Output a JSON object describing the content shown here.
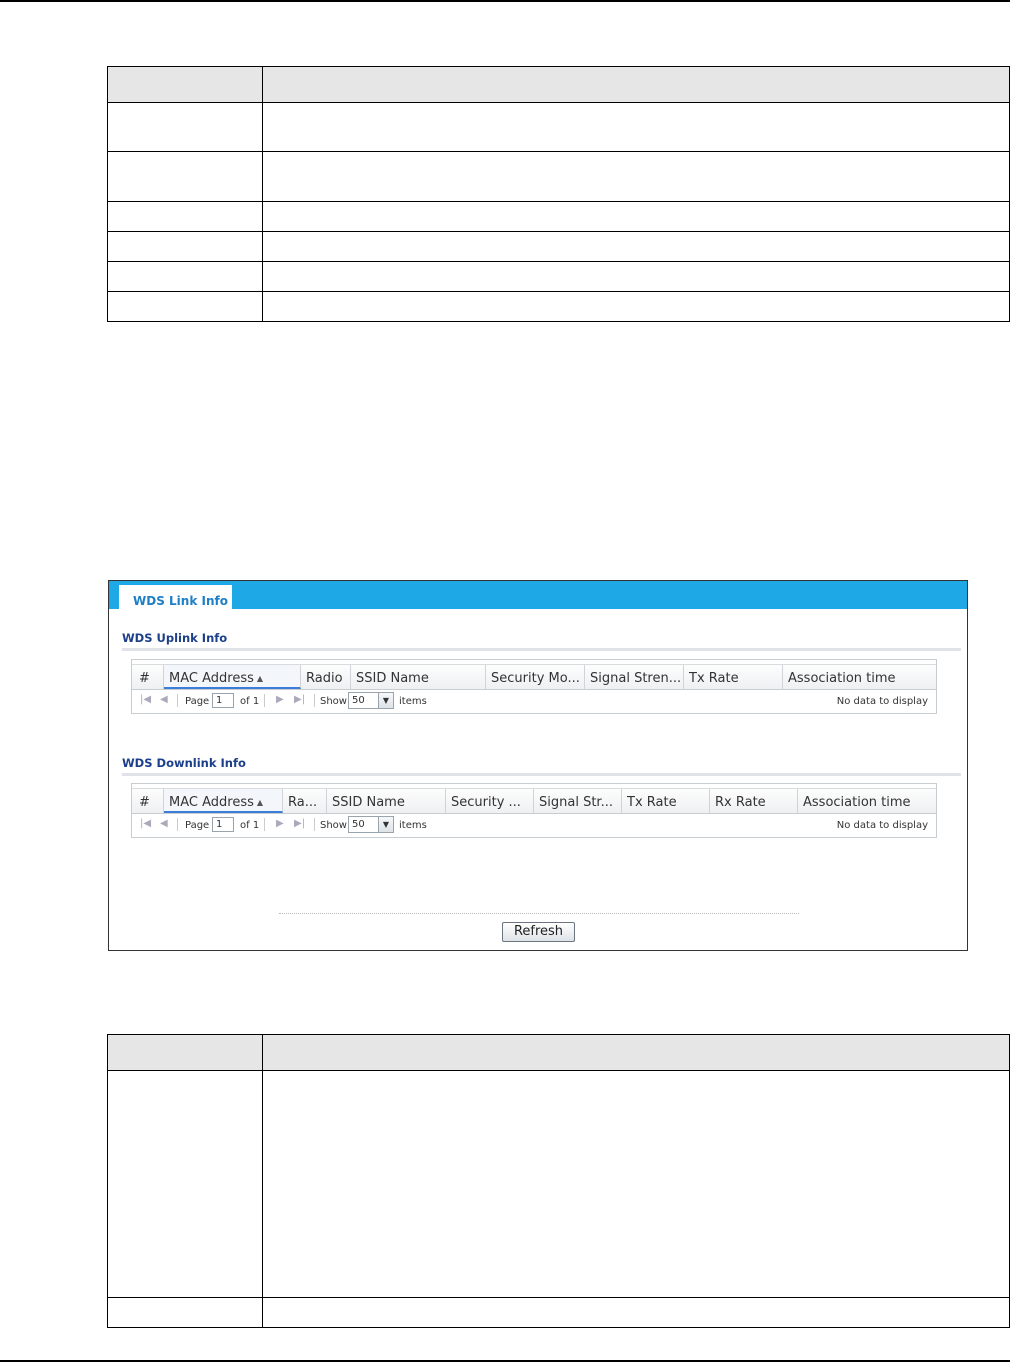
{
  "wds_link_info": {
    "tab_label": "WDS Link Info",
    "uplink": {
      "title": "WDS Uplink Info",
      "columns": [
        "#",
        "MAC Address",
        "Radio",
        "SSID Name",
        "Security Mo...",
        "Signal Stren...",
        "Tx Rate",
        "Association time"
      ],
      "pager": {
        "page_label": "Page",
        "page_value": "1",
        "of_label": "of 1",
        "show_label": "Show",
        "show_value": "50",
        "items_label": "items",
        "empty_text": "No data to display"
      }
    },
    "downlink": {
      "title": "WDS Downlink Info",
      "columns": [
        "#",
        "MAC Address",
        "Ra...",
        "SSID Name",
        "Security ...",
        "Signal Str...",
        "Tx Rate",
        "Rx Rate",
        "Association time"
      ],
      "pager": {
        "page_label": "Page",
        "page_value": "1",
        "of_label": "of 1",
        "show_label": "Show",
        "show_value": "50",
        "items_label": "items",
        "empty_text": "No data to display"
      }
    },
    "refresh_label": "Refresh"
  }
}
